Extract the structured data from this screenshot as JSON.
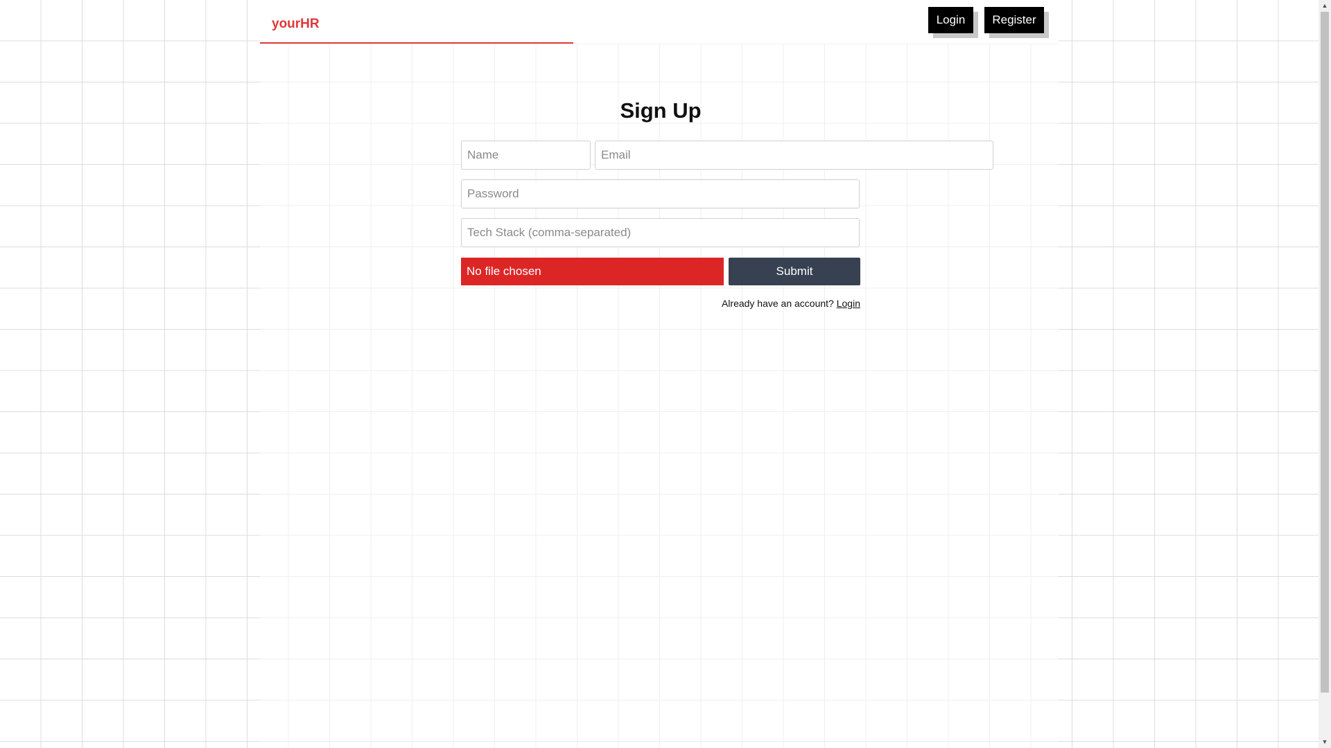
{
  "navbar": {
    "brand": "yourHR",
    "login_label": "Login",
    "register_label": "Register"
  },
  "form": {
    "title": "Sign Up",
    "name_placeholder": "Name",
    "email_placeholder": "Email",
    "password_placeholder": "Password",
    "tech_placeholder": "Tech Stack (comma-separated)",
    "file_label": "No file chosen",
    "submit_label": "Submit",
    "already_text": "Already have an account?",
    "login_link": "Login"
  },
  "colors": {
    "brand": "#e0373a",
    "file_button": "#dc2626",
    "submit_button": "#374151",
    "nav_button": "#000000"
  },
  "scrollbar": {
    "up_icon": "triangle-up-icon",
    "down_icon": "triangle-down-icon"
  }
}
